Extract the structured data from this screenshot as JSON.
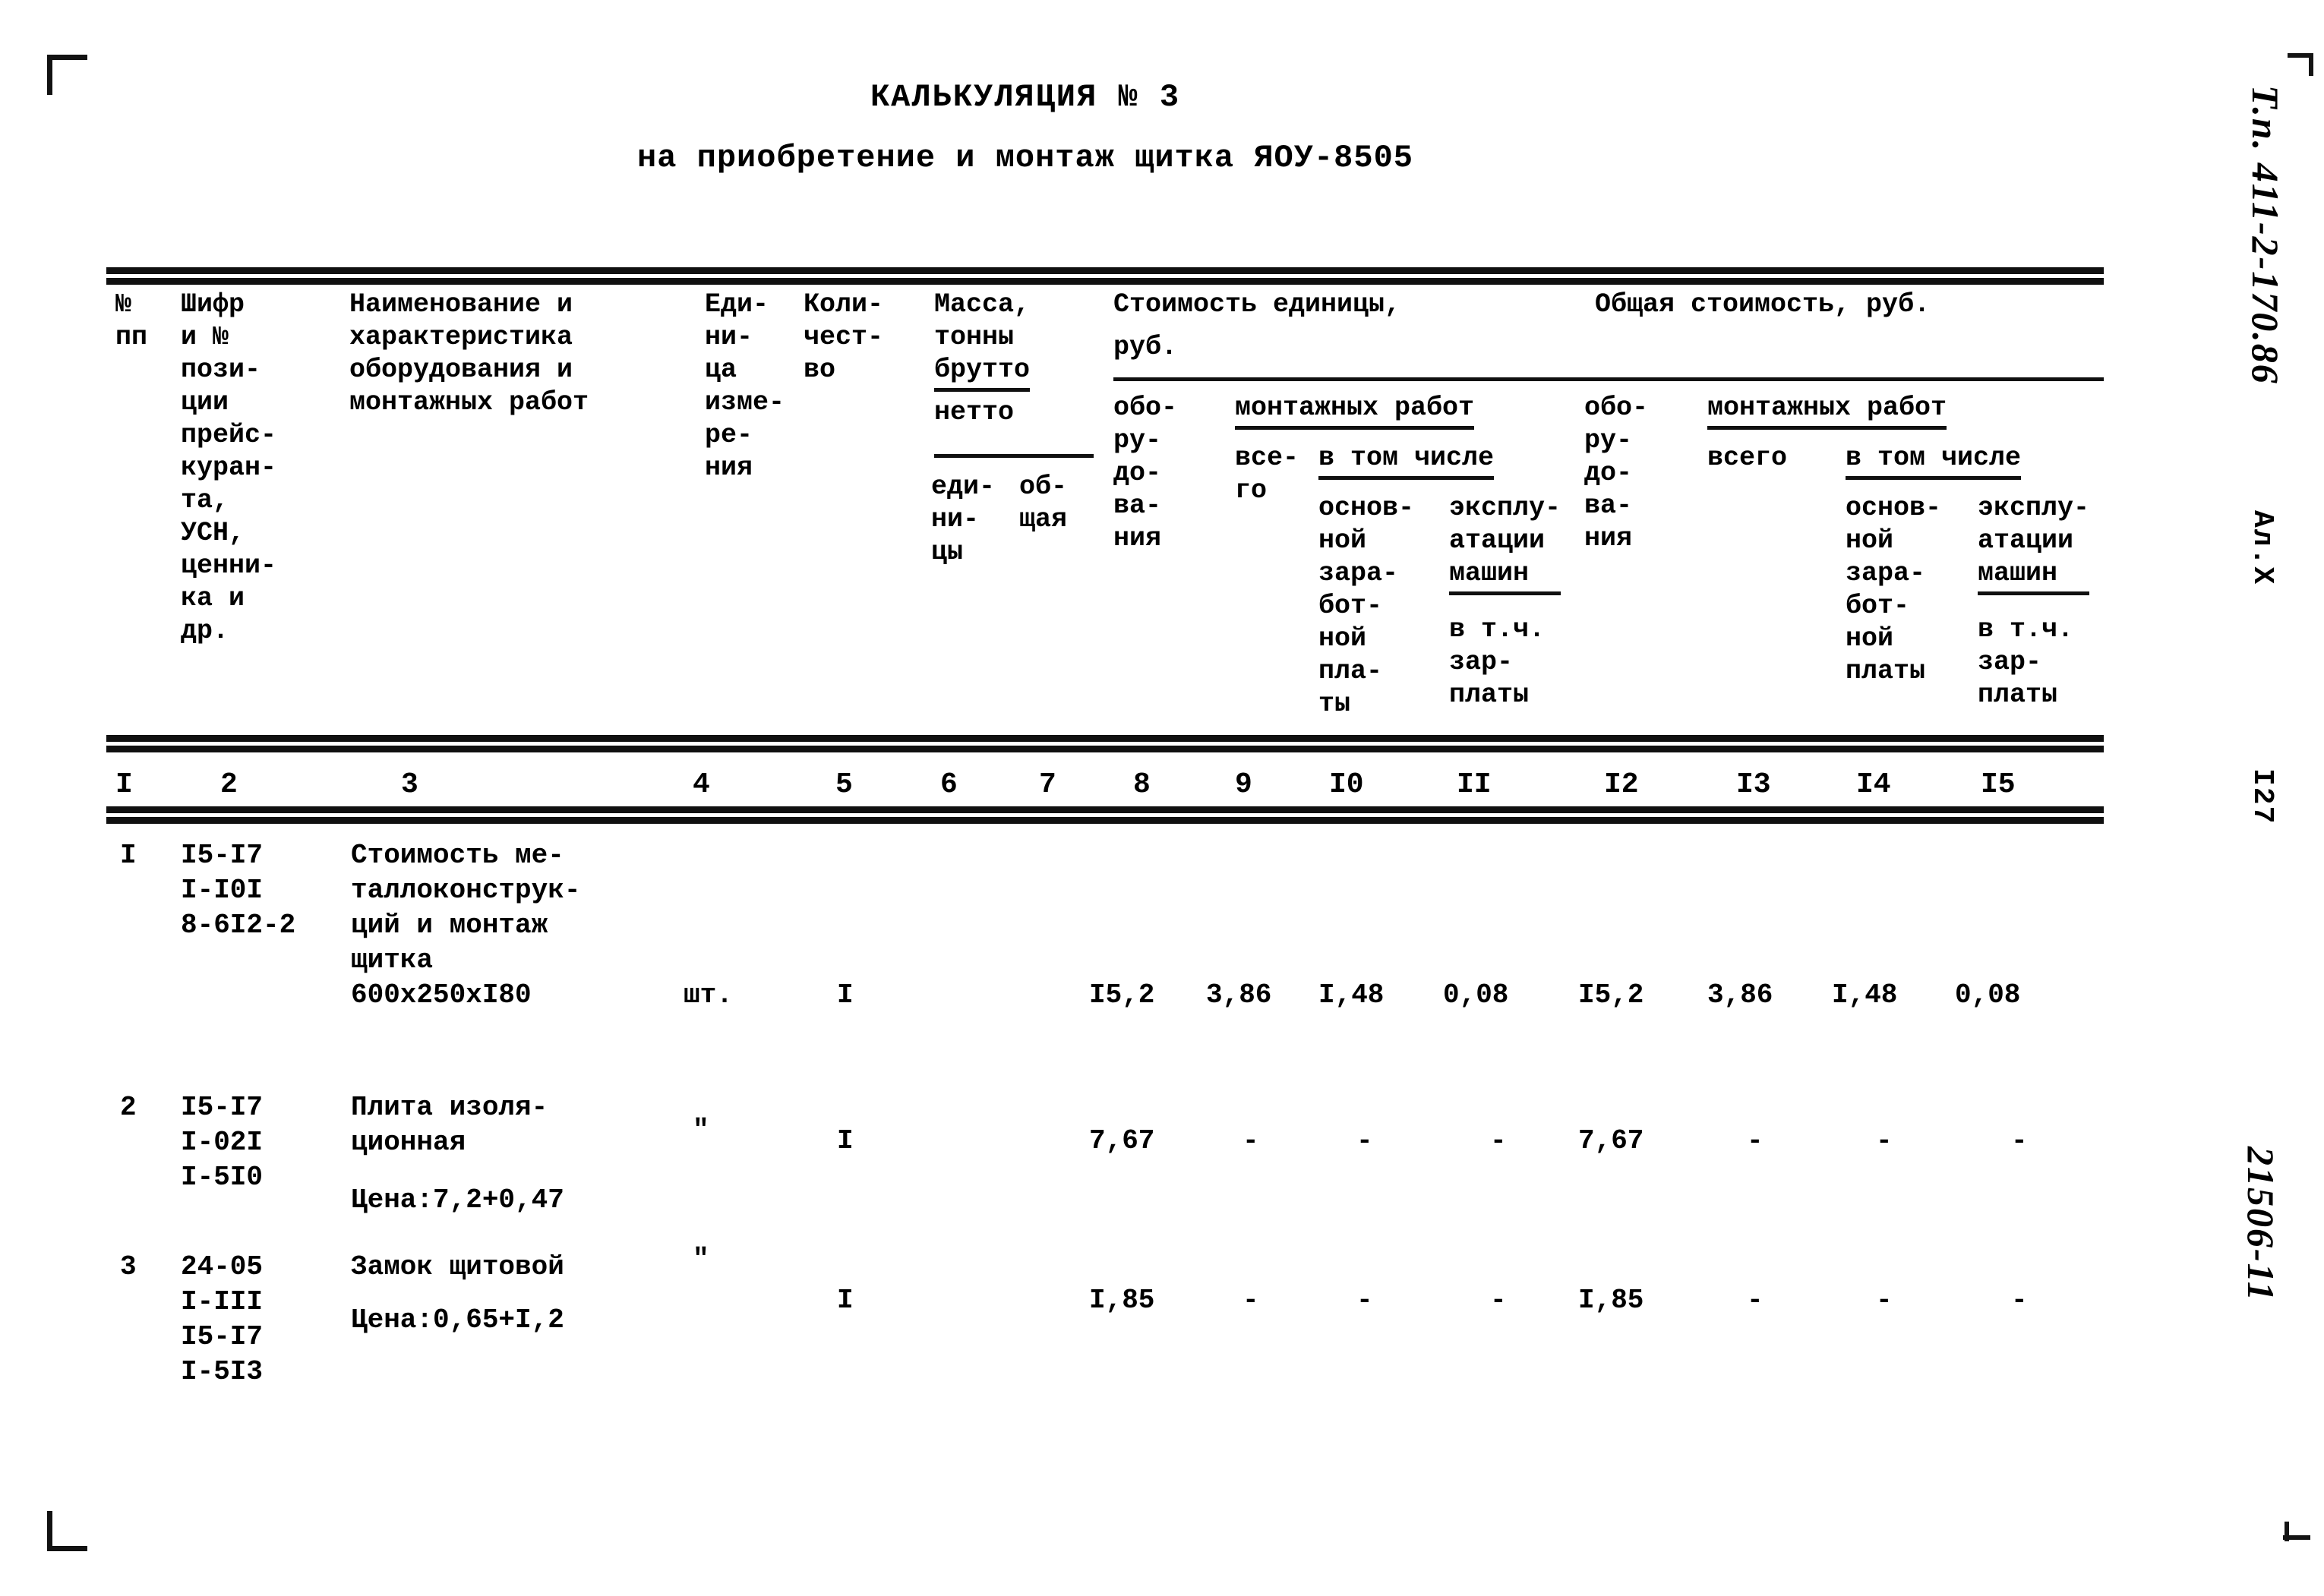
{
  "document": {
    "title": "КАЛЬКУЛЯЦИЯ № 3",
    "subtitle": "на приобретение и монтаж щитка ЯОУ-8505"
  },
  "margin_notes": {
    "project_code": "Т.п. 411-2-170.86",
    "album": "Ал.Х",
    "page_number": "I27",
    "archive_number": "21506-11"
  },
  "header": {
    "col1": "№\nпп",
    "col2": "Шифр\nи №\nпози-\nции\nпрейс-\nкуран-\nта,\nУСН,\nценни-\nка и\nдр.",
    "col3": "Наименование и\nхарактеристика\nоборудования и\nмонтажных работ",
    "col4": "Еди-\nни-\nца\nизме-\nре-\nния",
    "col5": "Коли-\nчест-\nво",
    "col6_title": "Масса,\nтонны",
    "col6_brutto": "брутто",
    "col6_netto": "нетто",
    "col6_unit": "еди-\nни-\nцы",
    "col7_total": "об-\nщая",
    "unit_cost_title": "Стоимость единицы,",
    "unit_cost_rub": "руб.",
    "unit_equipment": "обо-\nру-\nдо-\nва-\nния",
    "unit_install_works": "монтажных работ",
    "unit_all": "все-\nго",
    "unit_including": "в том числе",
    "unit_basic_wage": "основ-\nной\nзара-\nбот-\nной\nпла-\nты",
    "unit_machines": "эксплу-\nатации\nмашин",
    "unit_machines_wage": "в т.ч.\nзар-\nплаты",
    "total_cost_title": "Общая стоимость, руб.",
    "total_equipment": "обо-\nру-\nдо-\nва-\nния",
    "total_install_works": "монтажных работ",
    "total_all": "всего",
    "total_including": "в том числе",
    "total_basic_wage": "основ-\nной\nзара-\nбот-\nной\nплаты",
    "total_machines": "эксплу-\nатации\nмашин",
    "total_machines_wage": "в т.ч.\nзар-\nплаты"
  },
  "column_numbers": [
    "I",
    "2",
    "3",
    "4",
    "5",
    "6",
    "7",
    "8",
    "9",
    "I0",
    "II",
    "I2",
    "I3",
    "I4",
    "I5"
  ],
  "rows": [
    {
      "num": "I",
      "code": "I5-I7\nI-I0I\n8-6I2-2",
      "name": "Стоимость ме-\nталлоконструк-\nций и монтаж\nщитка\n600x250xI80",
      "unit": "шт.",
      "qty": "I",
      "mass_unit": "",
      "mass_total": "",
      "u_equipment": "I5,2",
      "u_all": "3,86",
      "u_basic_wage": "I,48",
      "u_machines": "",
      "u_machines_wage": "0,08",
      "t_equipment": "I5,2",
      "t_all": "3,86",
      "t_basic_wage": "I,48",
      "t_machines": "",
      "t_machines_wage": "0,08"
    },
    {
      "num": "2",
      "code": "I5-I7\nI-02I\nI-5I0",
      "name": "Плита изоля-\nционная",
      "name2": "Цена:7,2+0,47",
      "unit": "\"",
      "qty": "I",
      "mass_unit": "",
      "mass_total": "",
      "u_equipment": "7,67",
      "u_all": "-",
      "u_basic_wage": "-",
      "u_machines": "",
      "u_machines_wage": "-",
      "t_equipment": "7,67",
      "t_all": "-",
      "t_basic_wage": "-",
      "t_machines": "",
      "t_machines_wage": "-"
    },
    {
      "num": "3",
      "code": "24-05\nI-III\nI5-I7\nI-5I3",
      "name": "Замок щитовой",
      "name2": "Цена:0,65+I,2",
      "unit": "\"",
      "qty": "I",
      "mass_unit": "",
      "mass_total": "",
      "u_equipment": "I,85",
      "u_all": "-",
      "u_basic_wage": "-",
      "u_machines": "",
      "u_machines_wage": "-",
      "t_equipment": "I,85",
      "t_all": "-",
      "t_basic_wage": "-",
      "t_machines": "",
      "t_machines_wage": "-"
    }
  ]
}
